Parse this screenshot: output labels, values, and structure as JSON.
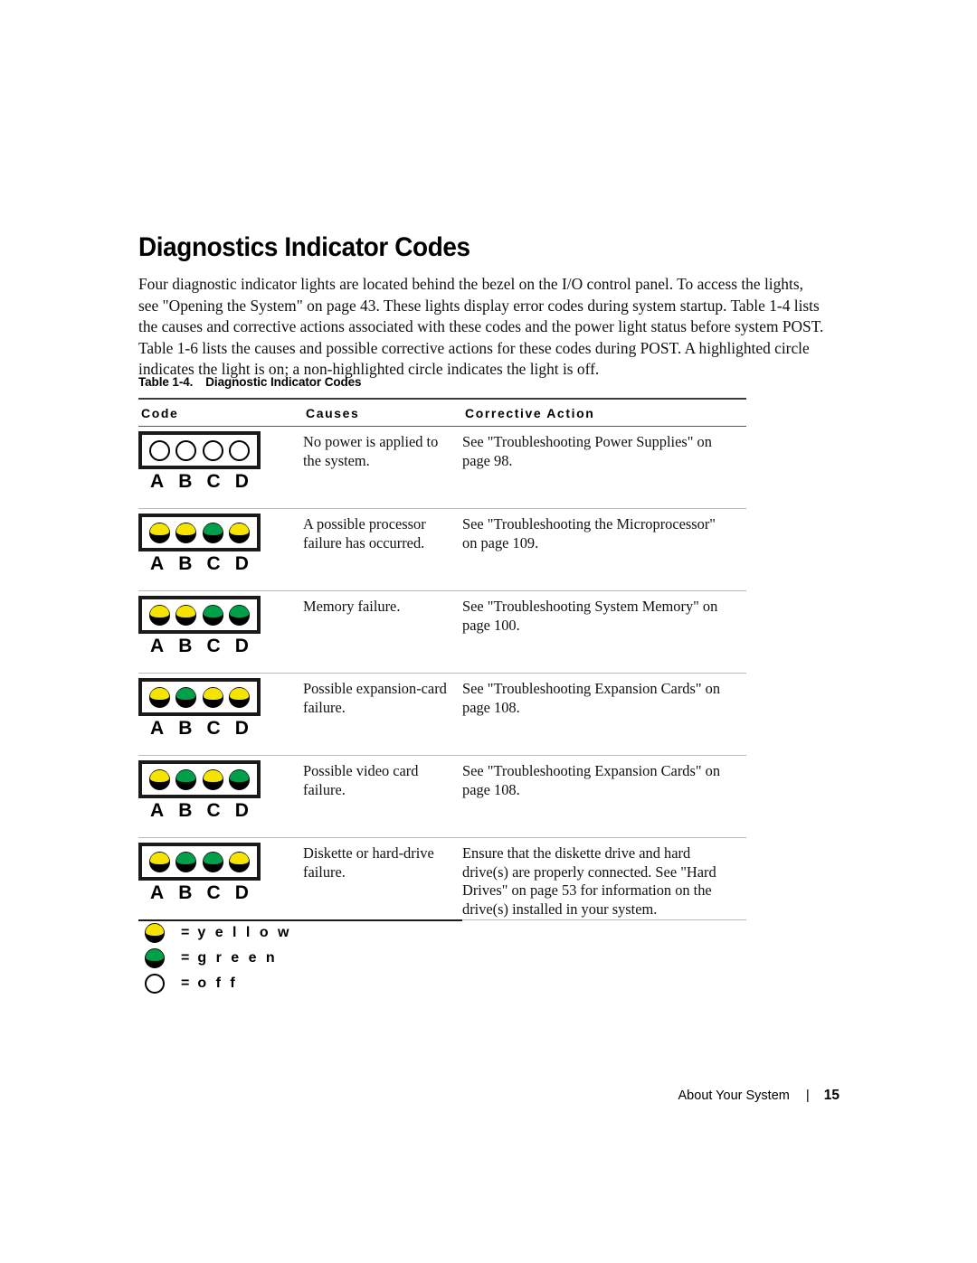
{
  "heading": "Diagnostics Indicator Codes",
  "intro": "Four diagnostic indicator lights are located behind the bezel on the I/O control panel. To access the lights, see \"Opening the System\" on page 43. These lights display error codes during system startup. Table 1-4 lists the causes and corrective actions associated with these codes and the power light status before system POST. Table 1-6 lists the causes and possible corrective actions for these codes during POST. A highlighted circle indicates the light is on; a non-highlighted circle indicates the light is off.",
  "table": {
    "caption_number": "Table 1-4.",
    "caption_title": "Diagnostic Indicator Codes",
    "headers": {
      "code": "Code",
      "causes": "Causes",
      "action": "Corrective Action"
    },
    "led_labels": [
      "A",
      "B",
      "C",
      "D"
    ],
    "rows": [
      {
        "leds": [
          "off",
          "off",
          "off",
          "off"
        ],
        "cause": "No power is applied to the system.",
        "action": "See \"Troubleshooting Power Supplies\" on page 98."
      },
      {
        "leds": [
          "yellow",
          "yellow",
          "green",
          "yellow"
        ],
        "cause": "A possible processor failure has occurred.",
        "action": "See \"Troubleshooting the Microprocessor\" on page 109."
      },
      {
        "leds": [
          "yellow",
          "yellow",
          "green",
          "green"
        ],
        "cause": "Memory failure.",
        "action": "See \"Troubleshooting System Memory\" on page 100."
      },
      {
        "leds": [
          "yellow",
          "green",
          "yellow",
          "yellow"
        ],
        "cause": "Possible expansion-card failure.",
        "action": "See \"Troubleshooting Expansion Cards\" on page 108."
      },
      {
        "leds": [
          "yellow",
          "green",
          "yellow",
          "green"
        ],
        "cause": "Possible video card failure.",
        "action": "See \"Troubleshooting Expansion Cards\" on page 108."
      },
      {
        "leds": [
          "yellow",
          "green",
          "green",
          "yellow"
        ],
        "cause": "Diskette or hard-drive failure.",
        "action": "Ensure that the diskette drive and hard drive(s) are properly connected. See \"Hard Drives\" on page 53 for information on the drive(s) installed in your system."
      }
    ]
  },
  "legend": {
    "equals": "=",
    "items": [
      {
        "state": "yellow",
        "label": "y e l l o w"
      },
      {
        "state": "green",
        "label": "g r e e n"
      },
      {
        "state": "off",
        "label": "o f f"
      }
    ]
  },
  "footer": {
    "section": "About Your System",
    "divider": "|",
    "page_number": "15"
  },
  "colors": {
    "yellow": "#f5e400",
    "green": "#00a04a",
    "off": "#ffffff",
    "panel_border": "#1a1a1a",
    "rule_dark": "#3a3a3a",
    "rule_light": "#b9b9b9"
  }
}
